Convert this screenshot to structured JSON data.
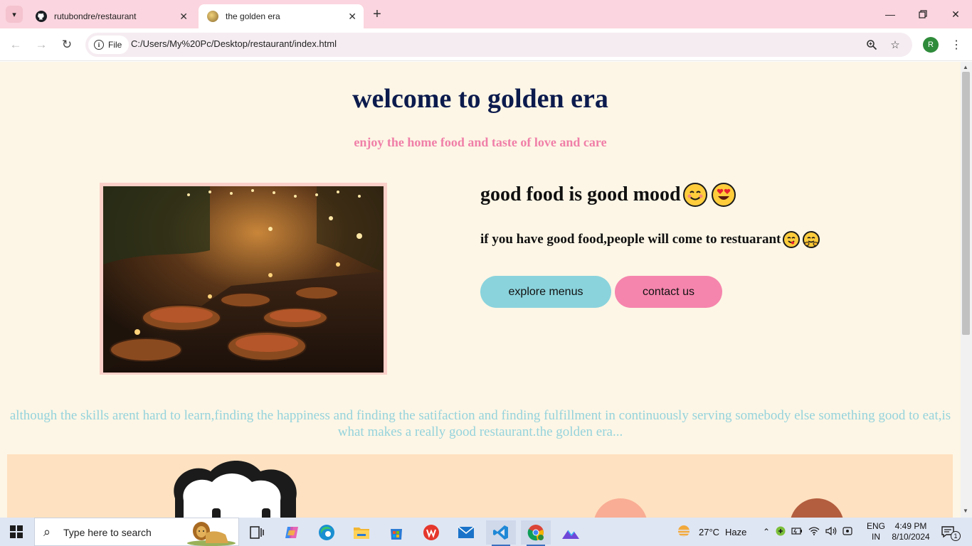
{
  "browser": {
    "tabs": [
      {
        "title": "rutubondre/restaurant",
        "icon": "github-icon"
      },
      {
        "title": "the golden era",
        "icon": "site-favicon"
      }
    ],
    "address": {
      "chip_label": "File",
      "url": "C:/Users/My%20Pc/Desktop/restaurant/index.html"
    },
    "profile_initial": "R"
  },
  "page": {
    "heading": "welcome to golden era",
    "subheading": "enjoy the home food and taste of love and care",
    "tagline": "good food is good mood",
    "subtagline": "if you have good food,people will come to restuarant",
    "buttons": {
      "explore": "explore menus",
      "contact": "contact us"
    },
    "quote": "although the skills arent hard to learn,finding the happiness and finding the satifaction and finding fulfillment in continuously serving somebody else something good to eat,is what makes a really good restaurant.the golden era...",
    "colors": {
      "heading": "#0c1b4d",
      "subheading": "#f07fa8",
      "explore_btn": "#8ad3dc",
      "contact_btn": "#f585ad",
      "quote": "#95d3dc",
      "background": "#fdf6e6"
    }
  },
  "taskbar": {
    "search_placeholder": "Type here to search",
    "weather": {
      "temp": "27°C",
      "condition": "Haze"
    },
    "language": {
      "line1": "ENG",
      "line2": "IN"
    },
    "clock": {
      "time": "4:49 PM",
      "date": "8/10/2024"
    },
    "notification_count": "1"
  }
}
